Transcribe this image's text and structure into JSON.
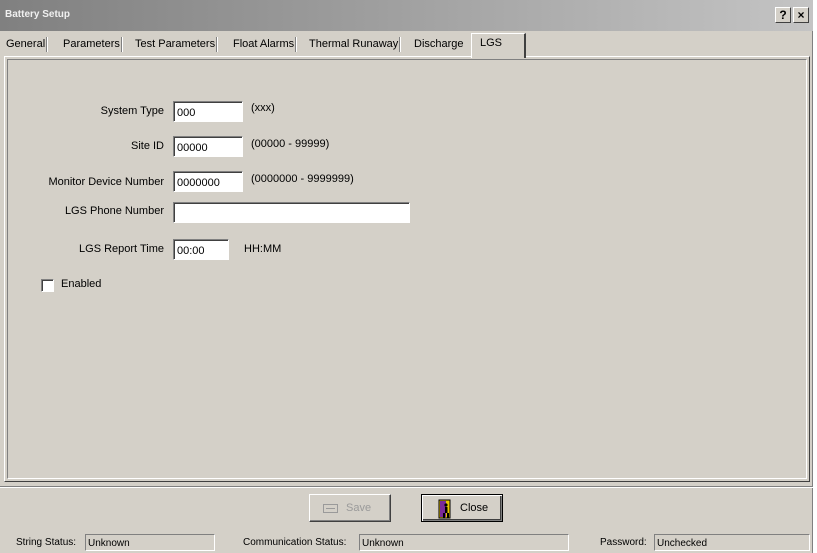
{
  "window": {
    "title": "Battery Setup",
    "help_btn": "?",
    "close_btn": "×"
  },
  "tabs": [
    {
      "label": "General"
    },
    {
      "label": "Parameters"
    },
    {
      "label": "Test Parameters"
    },
    {
      "label": "Float Alarms"
    },
    {
      "label": "Thermal Runaway"
    },
    {
      "label": "Discharge"
    },
    {
      "label": "LGS",
      "active": true
    }
  ],
  "form": {
    "system_type": {
      "label": "System Type",
      "value": "000",
      "hint": "(xxx)"
    },
    "site_id": {
      "label": "Site ID",
      "value": "00000",
      "hint": "(00000 - 99999)"
    },
    "monitor_device_number": {
      "label": "Monitor Device Number",
      "value": "0000000",
      "hint": "(0000000 - 9999999)"
    },
    "lgs_phone_number": {
      "label": "LGS Phone Number",
      "value": ""
    },
    "lgs_report_time": {
      "label": "LGS Report Time",
      "value": "00:00",
      "hint": "HH:MM"
    },
    "enabled": {
      "label": "Enabled",
      "checked": false
    }
  },
  "buttons": {
    "save": {
      "label": "Save",
      "enabled": false
    },
    "close": {
      "label": "Close"
    }
  },
  "statusbar": {
    "string_status_label": "String Status:",
    "string_status_value": "Unknown",
    "comm_status_label": "Communication Status:",
    "comm_status_value": "Unknown",
    "password_label": "Password:",
    "password_value": "Unchecked"
  }
}
